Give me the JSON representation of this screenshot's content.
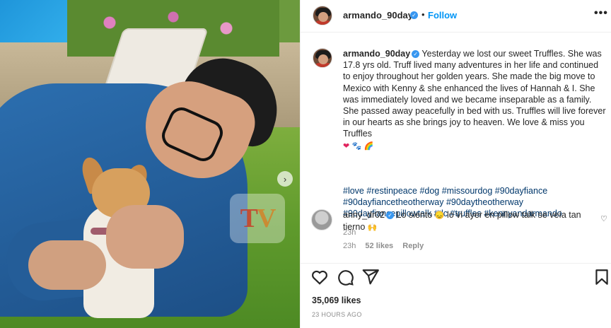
{
  "post": {
    "watermark": {
      "t": "T",
      "v": "V"
    }
  },
  "header": {
    "username": "armando_90day",
    "separator": "•",
    "follow_label": "Follow",
    "more_label": "•••"
  },
  "caption": {
    "username": "armando_90day",
    "text": " Yesterday we lost our sweet Truffles. She was 17.8 yrs old. Truff lived many adventures in her life and continued to enjoy throughout her golden years. She made the big move to Mexico with Kenny & she enhanced the lives of Hannah & I. She was immediately loved and we became inseparable as a family. She passed away peacefully in bed with us. Truffles will live forever in our hearts as she brings joy to heaven. We love & miss you Truffles",
    "emojis": {
      "heart": "❤",
      "paw": "🐾",
      "rainbow": "🌈"
    },
    "hashtags": [
      "#love",
      "#restinpeace",
      "#dog",
      "#missourdog",
      "#90dayfiance",
      "#90dayfiancetheotherway",
      "#90daytheotherway",
      "#90dayfiancepillowtalk",
      "#tlc",
      "#truffles",
      "#kennyandarmando"
    ],
    "time": "23h"
  },
  "comment": {
    "username": "anny_dr02",
    "text_before": " Lo siento ",
    "sad_emoji": "😞",
    "text_after": " lo vi ayer en pillow talk se veía tan tierno ",
    "hands_emoji": "🙌",
    "time": "23h",
    "likes": "52 likes",
    "reply_label": "Reply",
    "heart_icon": "heart-outline-icon"
  },
  "actions": {
    "likes": "35,069 likes",
    "timestamp": "23 HOURS AGO"
  },
  "colors": {
    "accent": "#0095f6",
    "verified": "#3897f0",
    "hashtag": "#00376b",
    "muted": "#8e8e8e"
  }
}
